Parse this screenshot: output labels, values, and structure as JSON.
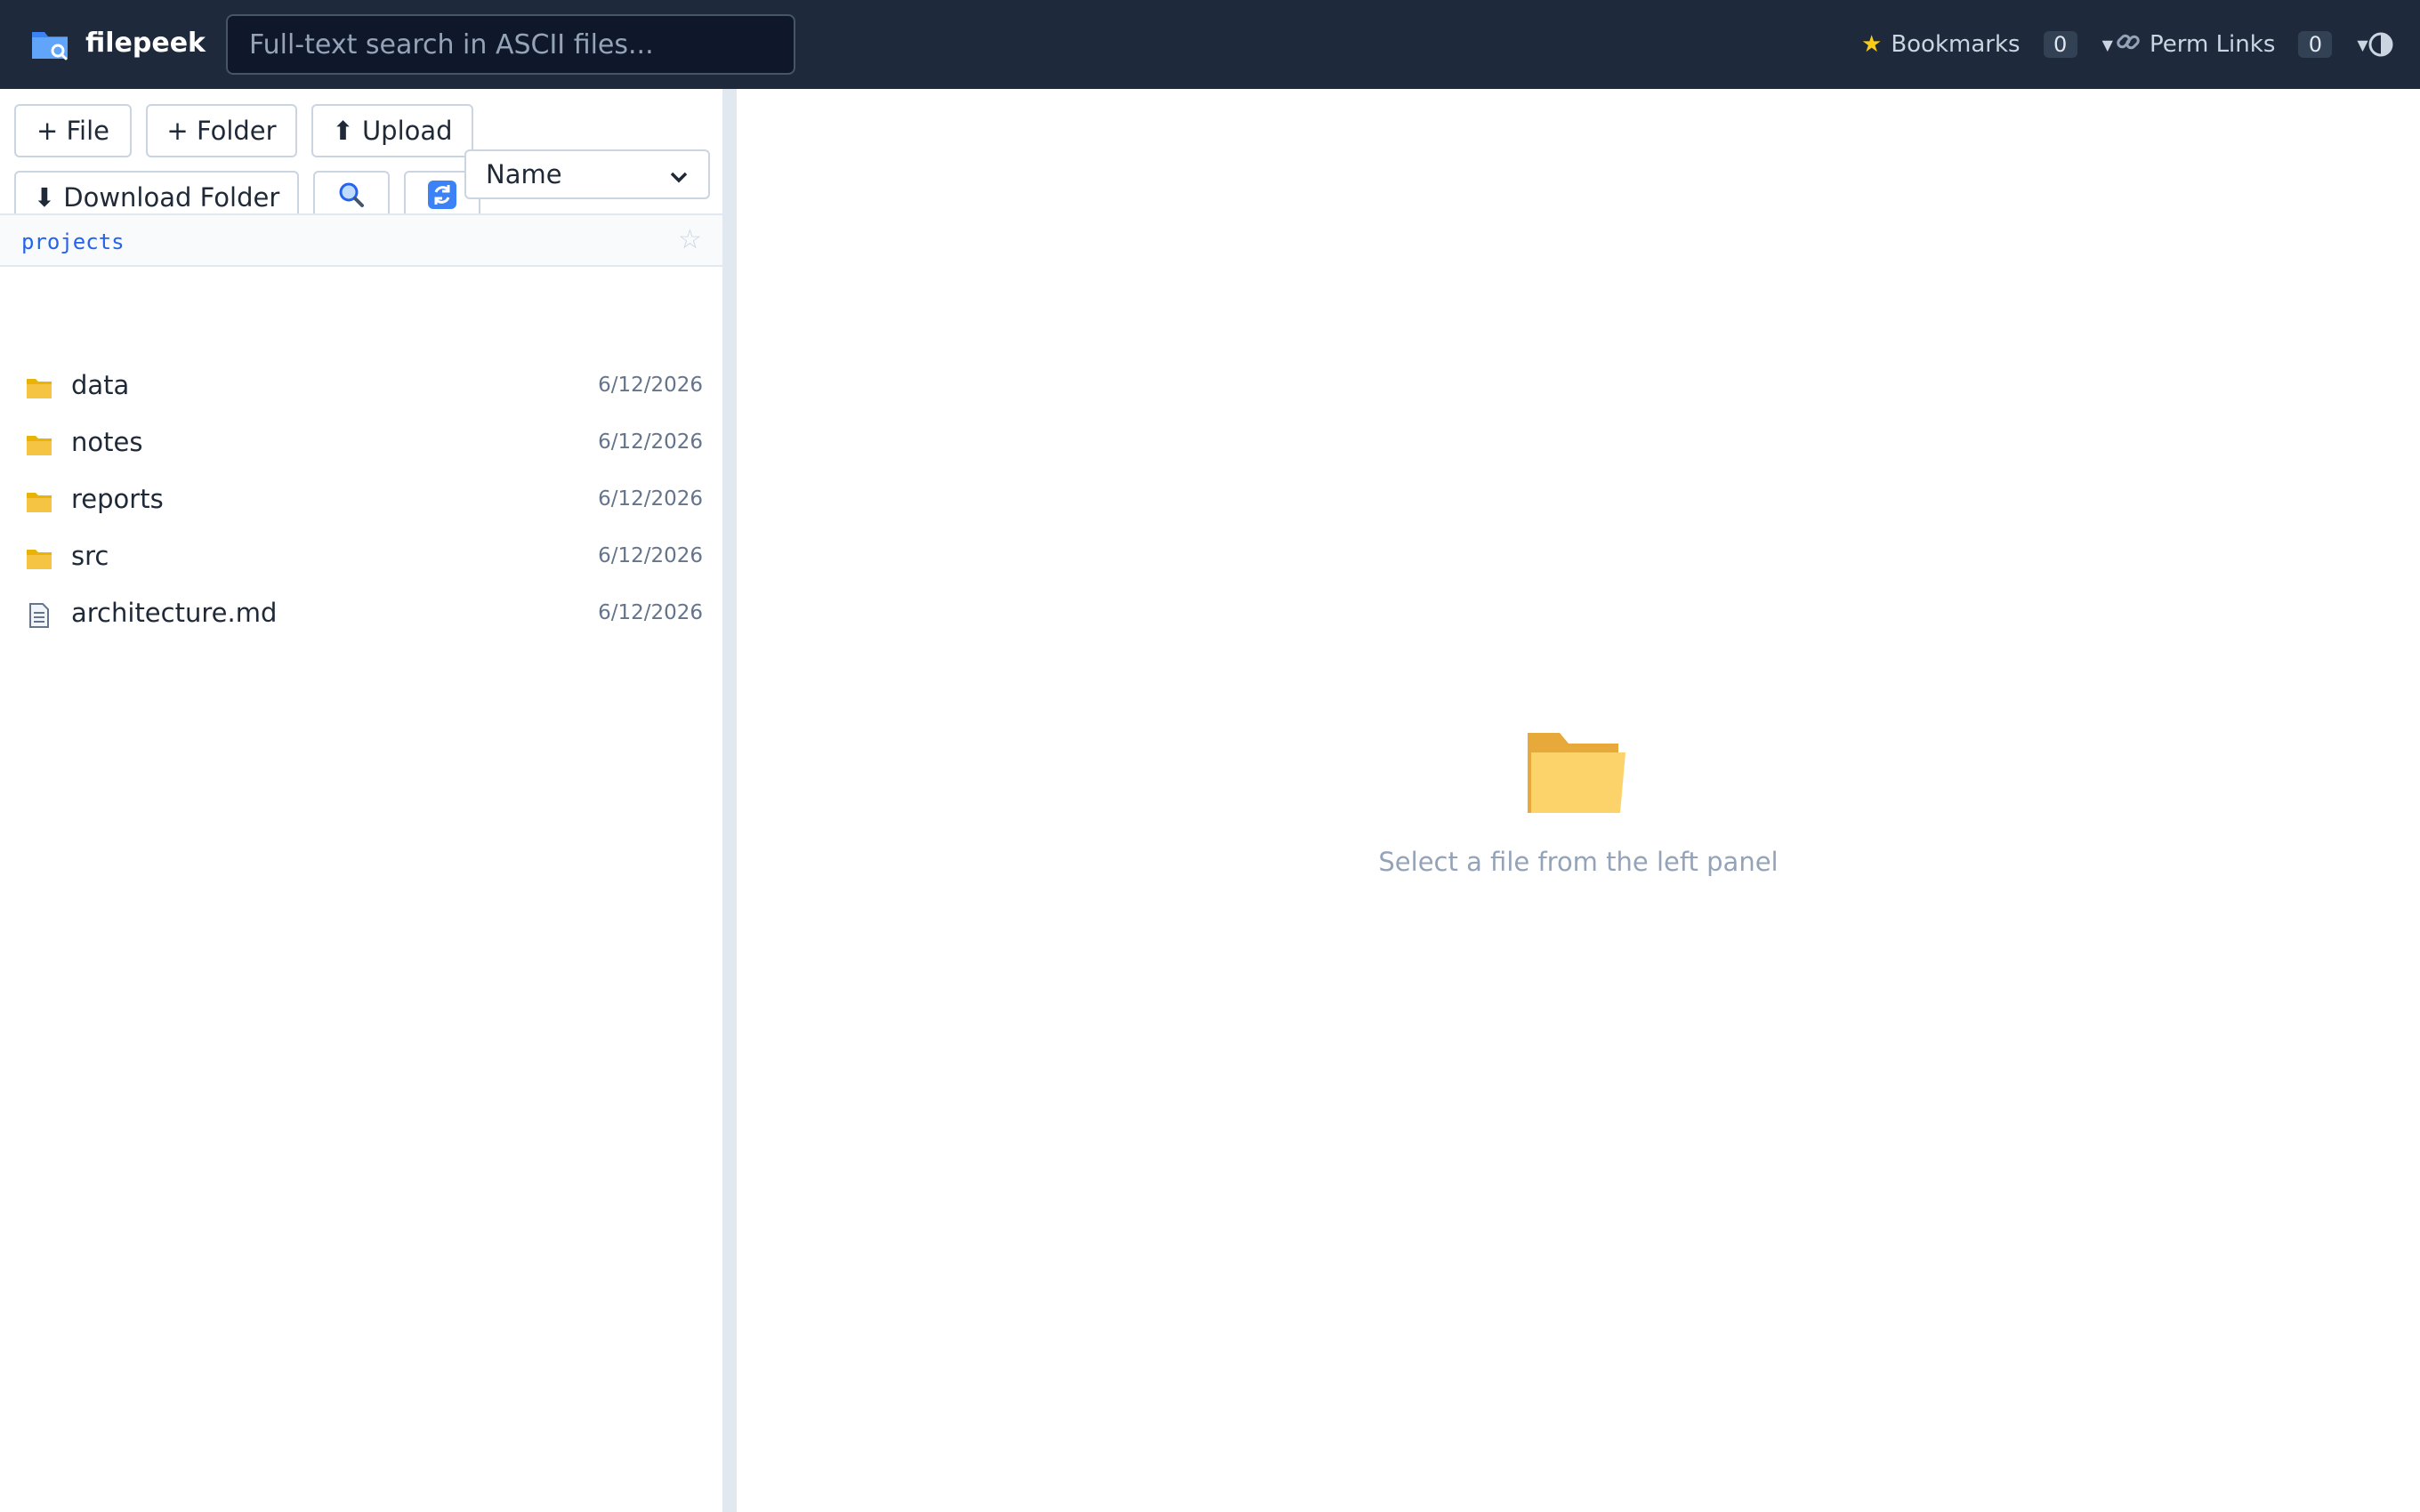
{
  "app": {
    "name": "filepeek"
  },
  "search": {
    "placeholder": "Full-text search in ASCII files..."
  },
  "header": {
    "bookmarks": {
      "label": "Bookmarks",
      "count": "0"
    },
    "perm_links": {
      "label": "Perm Links",
      "count": "0"
    }
  },
  "toolbar": {
    "new_file": "+ File",
    "new_folder": "+ Folder",
    "upload": "⬆ Upload",
    "download_folder": "⬇ Download Folder"
  },
  "sort": {
    "selected": "Name"
  },
  "breadcrumb": {
    "current": "projects"
  },
  "files": [
    {
      "name": "data",
      "type": "folder",
      "date": "6/12/2026"
    },
    {
      "name": "notes",
      "type": "folder",
      "date": "6/12/2026"
    },
    {
      "name": "reports",
      "type": "folder",
      "date": "6/12/2026"
    },
    {
      "name": "src",
      "type": "folder",
      "date": "6/12/2026"
    },
    {
      "name": "architecture.md",
      "type": "file",
      "date": "6/12/2026"
    }
  ],
  "empty_state": {
    "message": "Select a file from the left panel"
  },
  "colors": {
    "topbar": "#1e293b",
    "accent": "#2563eb",
    "folder": "#f6c443"
  }
}
